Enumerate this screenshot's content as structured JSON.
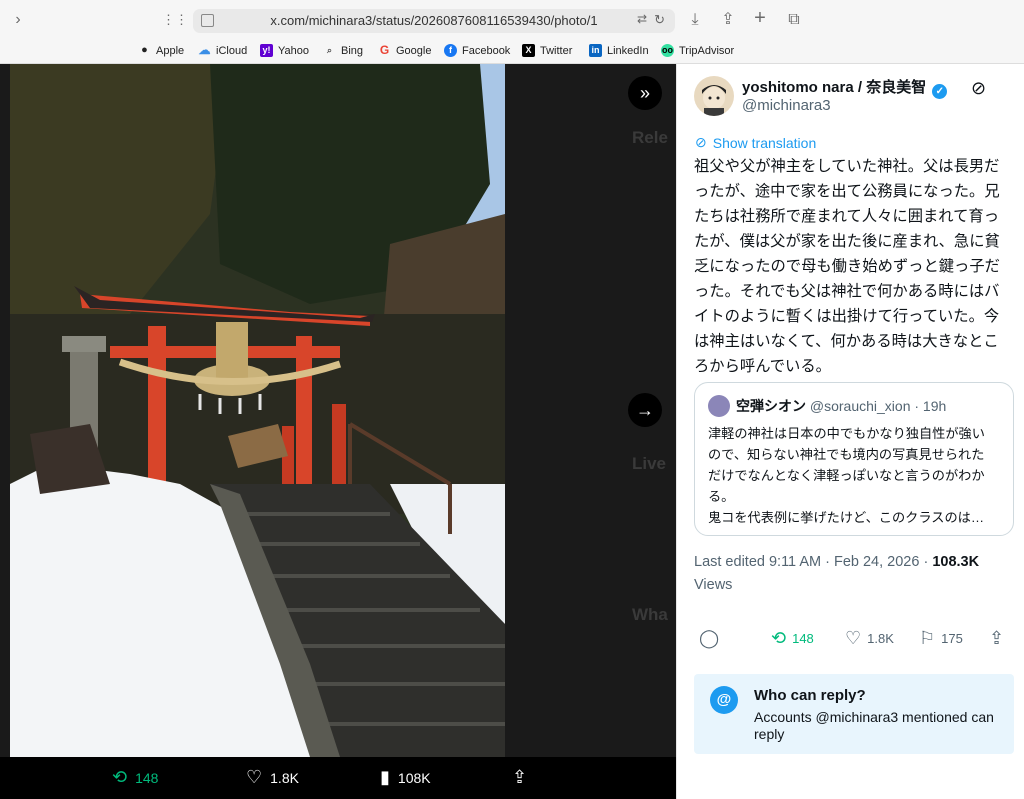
{
  "browser": {
    "url": "x.com/michinara3/status/2026087608116539430/photo/1",
    "bookmarks": [
      {
        "label": "Apple",
        "icon": "apple-icon"
      },
      {
        "label": "iCloud",
        "icon": "cloud-icon"
      },
      {
        "label": "Yahoo",
        "icon": "yahoo-icon"
      },
      {
        "label": "Bing",
        "icon": "search-icon"
      },
      {
        "label": "Google",
        "icon": "google-icon"
      },
      {
        "label": "Facebook",
        "icon": "facebook-icon"
      },
      {
        "label": "Twitter",
        "icon": "x-icon"
      },
      {
        "label": "LinkedIn",
        "icon": "linkedin-icon"
      },
      {
        "label": "TripAdvisor",
        "icon": "tripadvisor-icon"
      }
    ]
  },
  "media": {
    "background_fragments": [
      "Rele",
      "Live",
      "Wha"
    ],
    "bar": {
      "reposts": "148",
      "likes": "1.8K",
      "views": "108K"
    }
  },
  "post": {
    "author_name": "yoshitomo nara / 奈良美智",
    "handle": "@michinara3",
    "show_translation": "Show translation",
    "text_lines": [
      "祖父や父が神主をしていた神社。父は長男だ",
      "ったが、途中で家を出て公務員になった。兄",
      "たちは社務所で産まれて人々に囲まれて育っ",
      "たが、僕は父が家を出た後に産まれ、急に貧",
      "乏になったので母も働き始めずっと鍵っ子だ",
      "った。それでも父は神社で何かある時にはバ",
      "イトのように暫くは出掛けて行っていた。今",
      "は神主はいなくて、何かある時は大きなとこ",
      "ろから呼んでいる。"
    ],
    "quote": {
      "name": "空弾シオン",
      "meta": "@sorauchi_xion · 19h",
      "text_lines": [
        "津軽の神社は日本の中でもかなり独自性が強い",
        "ので、知らない神社でも境内の写真見せられた",
        "だけでなんとなく津軽っぽいなと言うのがわか",
        "る。",
        "鬼コを代表例に挙げたけど、このクラスのは…"
      ]
    },
    "edited": "Last edited 9:11 AM · Feb 24, 2026 · ",
    "views_count": "108.3K",
    "views_label": "Views",
    "reposts": "148",
    "likes": "1.8K",
    "bookmarks": "175",
    "reply_box": {
      "title": "Who can reply?",
      "text": "Accounts @michinara3 mentioned can reply"
    }
  },
  "colors": {
    "accent": "#1d9bf0",
    "repost_green": "#00ba7c",
    "torii_red": "#d8452a"
  }
}
